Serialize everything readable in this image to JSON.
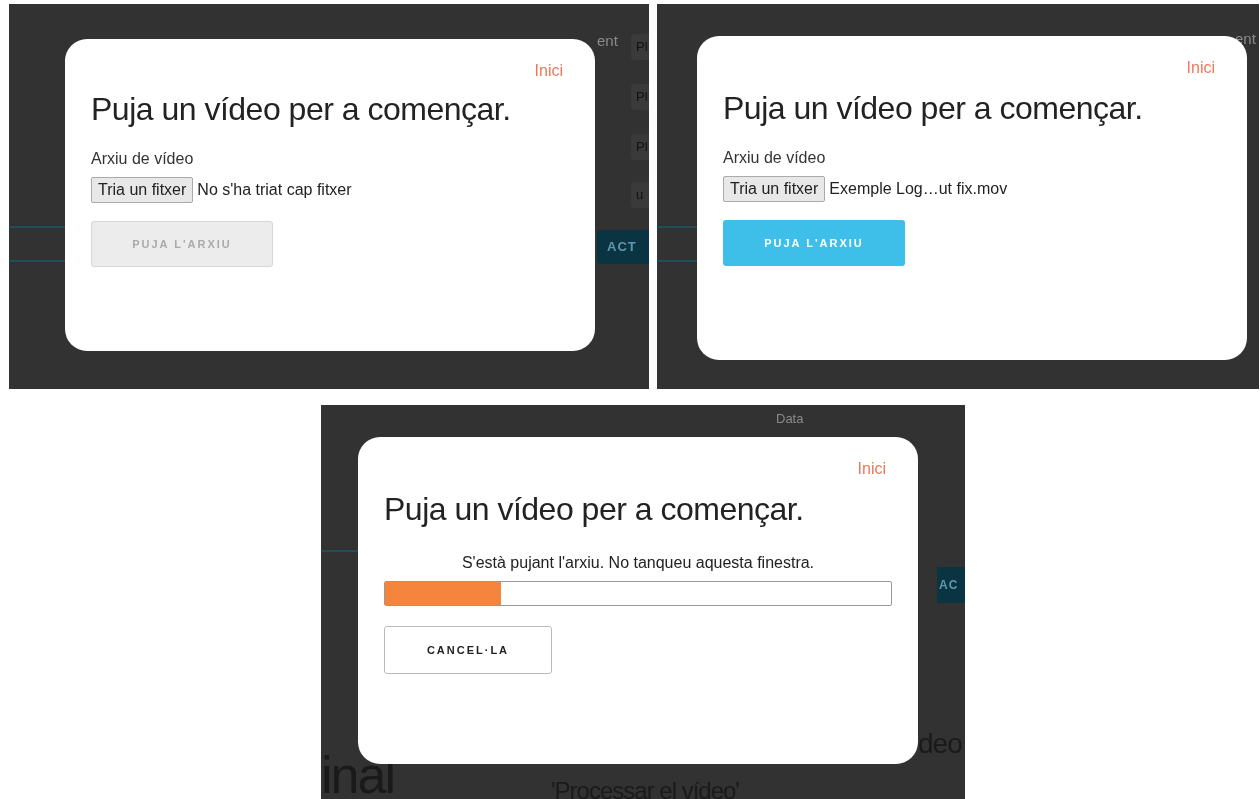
{
  "panels": [
    {
      "kind": "select",
      "background": {
        "label_fragment": "ent",
        "field_fragments": [
          "Pl",
          "Pl",
          "Pl",
          "u"
        ],
        "button_fragment": "ACT"
      },
      "modal": {
        "home_link": "Inici",
        "title": "Puja un vídeo per a començar.",
        "field_label": "Arxiu de vídeo",
        "file_button": "Tria un fitxer",
        "file_status": "No s'ha triat cap fitxer",
        "upload_button": {
          "label": "PUJA L'ARXIU",
          "disabled": true
        }
      }
    },
    {
      "kind": "select",
      "background": {
        "label_fragment": "ent"
      },
      "modal": {
        "home_link": "Inici",
        "title": "Puja un vídeo per a començar.",
        "field_label": "Arxiu de vídeo",
        "file_button": "Tria un fitxer",
        "file_status": "Exemple Log…ut fix.mov",
        "upload_button": {
          "label": "PUJA L'ARXIU",
          "disabled": false
        }
      }
    },
    {
      "kind": "progress",
      "background": {
        "label_fragment": "Data",
        "button_fragment": "AC",
        "heading_fragment": "inal",
        "text_fragments": [
          "deo",
          "'Processar el vídeo'"
        ]
      },
      "modal": {
        "home_link": "Inici",
        "title": "Puja un vídeo per a començar.",
        "message": "S'està pujant l'arxiu. No tanqueu aquesta finestra.",
        "progress": {
          "level": 0.23
        },
        "cancel_button": "CANCEL·LA"
      }
    }
  ]
}
